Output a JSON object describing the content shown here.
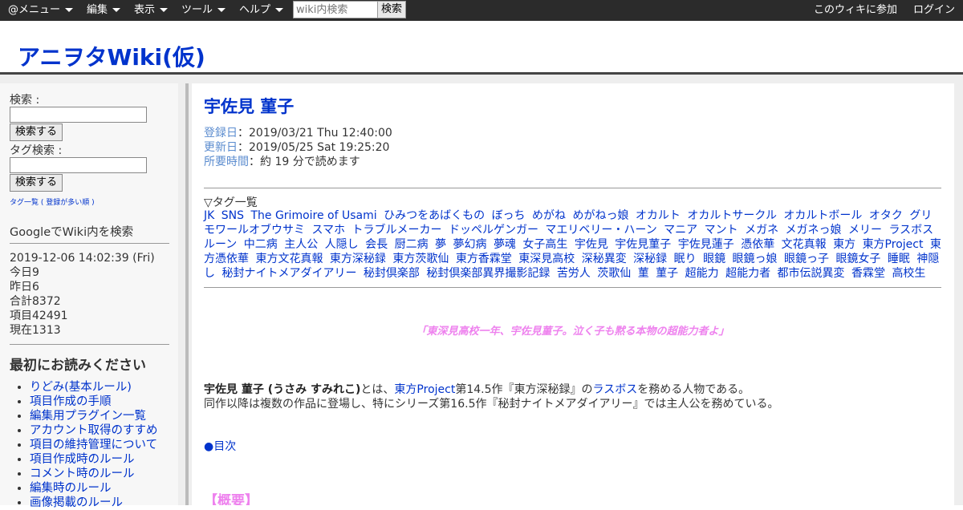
{
  "topbar": {
    "menus": [
      "@メニュー",
      "編集",
      "表示",
      "ツール",
      "ヘルプ"
    ],
    "search_placeholder": "wiki内検索",
    "search_button": "検索",
    "join": "このウィキに参加",
    "login": "ログイン"
  },
  "site": {
    "title": "アニヲタWiki(仮)"
  },
  "sidebar": {
    "search_label": "検索 :",
    "search_button": "検索する",
    "tag_search_label": "タグ検索 :",
    "tag_search_button": "検索する",
    "tag_links": [
      "タグ一覧",
      "( 登録が多い順 )"
    ],
    "google_search": "GoogleでWiki内を検索",
    "stats": {
      "datetime": "2019-12-06 14:02:39 (Fri)",
      "today": "今日9",
      "yesterday": "昨日6",
      "total": "合計8372",
      "items": "項目42491",
      "now": "現在1313"
    },
    "heading": "最初にお読みください",
    "links": [
      "りどみ(基本ルール)",
      "項目作成の手順",
      "編集用プラグイン一覧",
      "アカウント取得のすすめ",
      "項目の維持管理について",
      "項目作成時のルール",
      "コメント時のルール",
      "編集時のルール",
      "画像掲載のルール"
    ]
  },
  "main": {
    "title": "宇佐見 菫子",
    "meta": {
      "registered_label": "登録日",
      "registered": "：2019/03/21 Thu 12:40:00",
      "updated_label": "更新日",
      "updated": "：2019/05/25 Sat 19:25:20",
      "reading_label": "所要時間",
      "reading": "：約 19 分で読めます"
    },
    "tags_heading": "▽タグ一覧",
    "tags": [
      "JK",
      "SNS",
      "The Grimoire of Usami",
      "ひみつをあばくもの",
      "ぼっち",
      "めがね",
      "めがねっ娘",
      "オカルト",
      "オカルトサークル",
      "オカルトボール",
      "オタク",
      "グリモワールオブウサミ",
      "スマホ",
      "トラブルメーカー",
      "ドッペルゲンガー",
      "マエリベリー・ハーン",
      "マニア",
      "マント",
      "メガネ",
      "メガネっ娘",
      "メリー",
      "ラスボス",
      "ルーン",
      "中二病",
      "主人公",
      "人隠し",
      "会長",
      "厨二病",
      "夢",
      "夢幻病",
      "夢魂",
      "女子高生",
      "宇佐見",
      "宇佐見菫子",
      "宇佐見蓮子",
      "憑依華",
      "文花真報",
      "東方",
      "東方Project",
      "東方憑依華",
      "東方文花真報",
      "東方深秘録",
      "東方茨歌仙",
      "東方香霖堂",
      "東深見高校",
      "深秘異変",
      "深秘録",
      "眠り",
      "眼鏡",
      "眼鏡っ娘",
      "眼鏡っ子",
      "眼鏡女子",
      "睡眠",
      "神隠し",
      "秘封ナイトメアダイアリー",
      "秘封倶楽部",
      "秘封倶楽部異界撮影記録",
      "苦労人",
      "茨歌仙",
      "菫",
      "菫子",
      "超能力",
      "超能力者",
      "都市伝説異変",
      "香霖堂",
      "高校生"
    ],
    "quote": "「東深見高校一年、宇佐見菫子。泣く子も黙る本物の超能力者よ」",
    "intro": {
      "name": "宇佐見 菫子 (うさみ すみれこ)",
      "t1": "とは、",
      "link1": "東方Project",
      "t2": "第14.5作『東方深秘録』の",
      "link2": "ラスボス",
      "t3": "を務める人物である。",
      "line2": "同作以降は複数の作品に登場し、特にシリーズ第16.5作『秘封ナイトメアダイアリー』では主人公を務めている。"
    },
    "toc": "●目次",
    "overview": "【概要】"
  },
  "colors": {
    "topbar_bg": "#2b2b2b",
    "link": "#0033cc",
    "meta_label": "#5b8ccf",
    "accent_pink": "#ee82ee"
  },
  "icons": [
    "caret-down-icon"
  ]
}
